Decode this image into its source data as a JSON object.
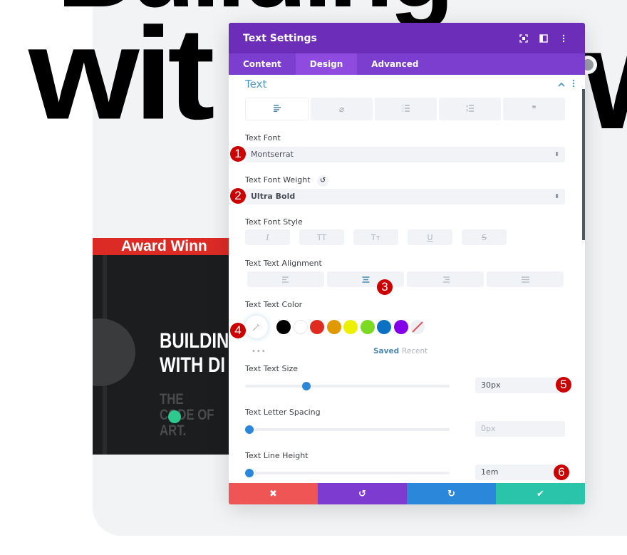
{
  "background": {
    "headline_top": "Building",
    "headline": "wit",
    "headline_right": "w",
    "book": {
      "banner": "Award Winn",
      "title_lines": "BUILDIN\nWITH DI",
      "subtitle": "THE\nCODE OF\nART."
    }
  },
  "modal": {
    "title": "Text Settings",
    "header_icons": [
      "focus-icon",
      "split-view-icon",
      "more-vertical-icon"
    ],
    "tabs": [
      {
        "label": "Content",
        "active": false
      },
      {
        "label": "Design",
        "active": true
      },
      {
        "label": "Advanced",
        "active": false
      }
    ],
    "section": {
      "title": "Text",
      "text_style_tabs": [
        {
          "icon": "paragraph-icon",
          "glyph": "≡",
          "active": true
        },
        {
          "icon": "link-icon",
          "glyph": "⌀",
          "active": false
        },
        {
          "icon": "unordered-list-icon",
          "glyph": "☰",
          "active": false
        },
        {
          "icon": "ordered-list-icon",
          "glyph": "☰",
          "active": false
        },
        {
          "icon": "quote-icon",
          "glyph": "❞",
          "active": false
        }
      ]
    },
    "fields": {
      "font": {
        "label": "Text Font",
        "value": "Montserrat"
      },
      "font_weight": {
        "label": "Text Font Weight",
        "value": "Ultra Bold"
      },
      "font_style": {
        "label": "Text Font Style",
        "options": [
          {
            "name": "italic",
            "glyph": "I"
          },
          {
            "name": "uppercase",
            "glyph": "TT"
          },
          {
            "name": "capitalize",
            "glyph": "Tт"
          },
          {
            "name": "underline",
            "glyph": "U"
          },
          {
            "name": "strikethrough",
            "glyph": "S"
          }
        ]
      },
      "alignment": {
        "label": "Text Text Alignment",
        "options": [
          "left",
          "center",
          "right",
          "justify"
        ],
        "selected": "center"
      },
      "color": {
        "label": "Text Text Color",
        "swatches": [
          "#000000",
          "#ffffff",
          "#e02b20",
          "#e09900",
          "#edf000",
          "#7cda24",
          "#0c71c3",
          "#8300e9"
        ],
        "saved_label": "Saved",
        "recent_label": "Recent",
        "more": "•••"
      },
      "text_size": {
        "label": "Text Text Size",
        "value": "30px",
        "slider_fraction": 0.3
      },
      "letter_spacing": {
        "label": "Text Letter Spacing",
        "value": "0px",
        "slider_fraction": 0.0
      },
      "line_height": {
        "label": "Text Line Height",
        "value": "1em",
        "slider_fraction": 0.0
      }
    },
    "footer": {
      "cancel": "✖",
      "undo": "↺",
      "redo": "↻",
      "save": "✔"
    }
  },
  "markers": [
    "1",
    "2",
    "3",
    "4",
    "5",
    "6"
  ]
}
